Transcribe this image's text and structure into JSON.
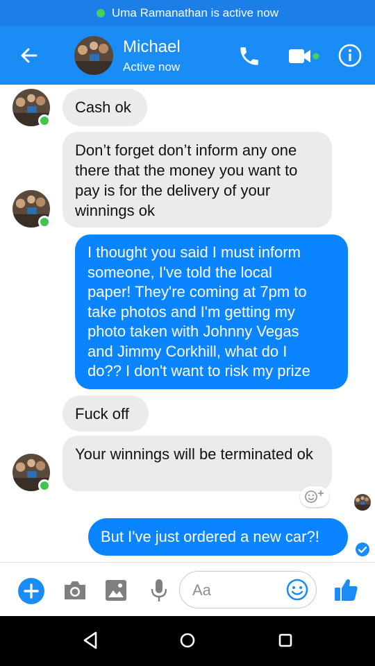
{
  "top_banner": {
    "text": "Uma Ramanathan is active now"
  },
  "header": {
    "name": "Michael",
    "status": "Active now"
  },
  "messages": [
    {
      "from": "Michael",
      "text": "Cash ok"
    },
    {
      "from": "Michael",
      "text": "Don’t forget don’t inform any one there that the money you want to pay is for the delivery of your winnings ok"
    },
    {
      "from": "me",
      "lines": [
        "I thought you said I must inform",
        "someone, I've told the local",
        "paper! They're coming at 7pm to",
        "take photos and I'm getting my",
        "photo taken with Johnny Vegas",
        "and Jimmy Corkhill, what do I",
        "do?? I don't want to risk my prize"
      ]
    },
    {
      "from": "Michael",
      "text": "Fuck off"
    },
    {
      "from": "Michael",
      "text": "Your winnings will be terminated ok"
    },
    {
      "from": "me",
      "text": "But I've just ordered a new car?!"
    }
  ],
  "composer": {
    "placeholder": "Aa"
  },
  "colors": {
    "brand_blue": "#1a8cf6",
    "outgoing_bubble": "#0a84ff",
    "incoming_bubble": "#ebebeb",
    "online_green": "#42c54b"
  },
  "icons": [
    "back-arrow-icon",
    "phone-icon",
    "video-camera-icon",
    "info-icon",
    "plus-icon",
    "camera-icon",
    "image-icon",
    "microphone-icon",
    "emoji-icon",
    "thumbs-up-icon",
    "add-reaction-icon",
    "check-icon",
    "nav-back-icon",
    "nav-home-icon",
    "nav-recents-icon"
  ]
}
